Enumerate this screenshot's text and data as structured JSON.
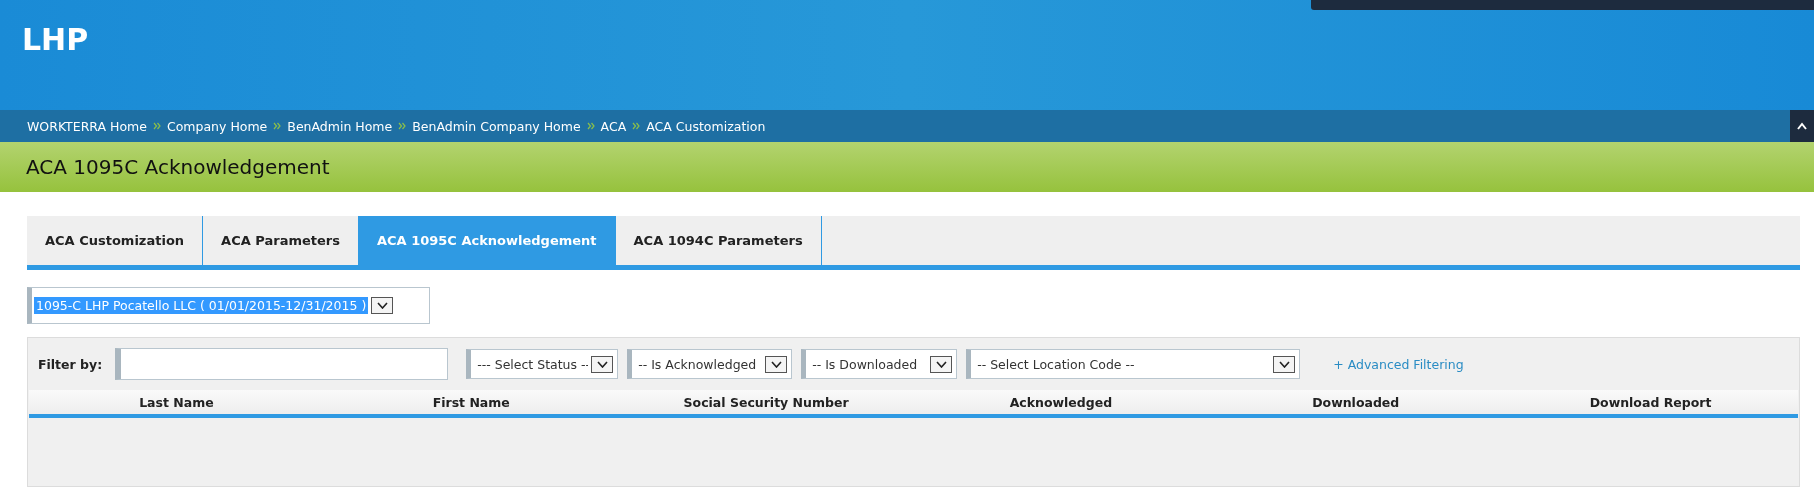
{
  "header": {
    "logo": "LHP"
  },
  "breadcrumbs": [
    {
      "label": "WORKTERRA Home"
    },
    {
      "label": "Company Home"
    },
    {
      "label": "BenAdmin Home"
    },
    {
      "label": "BenAdmin Company Home"
    },
    {
      "label": "ACA"
    },
    {
      "label": "ACA Customization"
    }
  ],
  "page_title": "ACA 1095C Acknowledgement",
  "tabs": [
    {
      "label": "ACA Customization",
      "selected": false
    },
    {
      "label": "ACA Parameters",
      "selected": false
    },
    {
      "label": "ACA 1095C Acknowledgement",
      "selected": true
    },
    {
      "label": "ACA 1094C Parameters",
      "selected": false
    }
  ],
  "form_select": {
    "value": "1095-C LHP Pocatello LLC ( 01/01/2015-12/31/2015 )"
  },
  "filter": {
    "label": "Filter by:",
    "selects": [
      {
        "value": "--- Select Status --"
      },
      {
        "value": "-- Is Acknowledged"
      },
      {
        "value": "-- Is Downloaded"
      },
      {
        "value": "-- Select Location Code --"
      }
    ],
    "advanced_link": "+ Advanced Filtering"
  },
  "table": {
    "columns": [
      "Last Name",
      "First Name",
      "Social Security Number",
      "Acknowledged",
      "Downloaded",
      "Download Report"
    ]
  }
}
